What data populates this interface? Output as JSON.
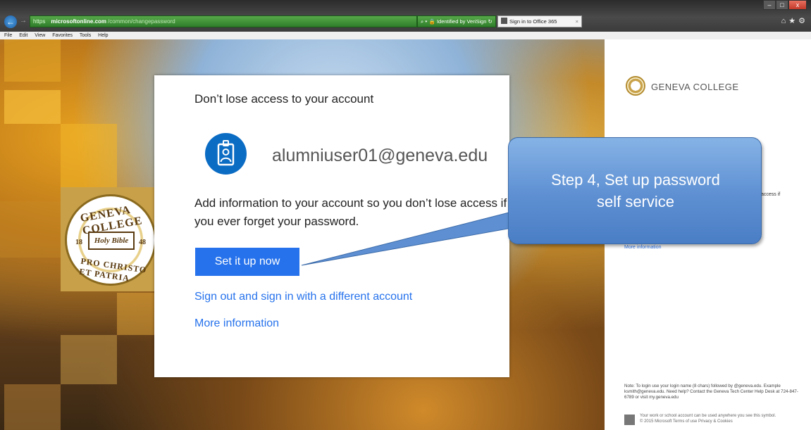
{
  "browser": {
    "address_scheme": "https",
    "address_host": "microsoftonline.com",
    "address_path": "/common/changepassword",
    "cert_text": "⌕ ▾  🔒 Identified by VeriSign  ↻",
    "tab_title": "Sign in to Office 365",
    "tab_close": "×",
    "back_glyph": "←",
    "fwd_glyph": "→",
    "win_min": "–",
    "win_max": "□",
    "win_close": "x",
    "tool_icons": "⌂★⚙",
    "menu": [
      "File",
      "Edit",
      "View",
      "Favorites",
      "Tools",
      "Help"
    ]
  },
  "seal": {
    "top": "GENEVA COLLEGE",
    "book": "Holy Bible",
    "year_left": "18",
    "year_right": "48",
    "bottom": "PRO CHRISTO ET PATRIA"
  },
  "right_pane": {
    "org_name": "GENEVA COLLEGE",
    "access_fragment": "access if",
    "more_information": "More information",
    "note": "Note: To login use your login name (8 chars) followed by @geneva.edu. Example ksmith@geneva.edu. Need help? Contact the Geneva Tech Center Help Desk at 724-847-6789 or visit my.geneva.edu",
    "footer_line1": "Your work or school account can be used anywhere you see this symbol.",
    "footer_line2": "© 2015 Microsoft  Terms of use  Privacy & Cookies"
  },
  "modal": {
    "title": "Don’t lose access to your account",
    "email": "alumniuser01@geneva.edu",
    "description": "Add information to your account so you don’t lose access if you ever forget your password.",
    "button_label": "Set it up now",
    "link_switch": "Sign out and sign in with a different account",
    "link_more": "More information"
  },
  "callout": {
    "line1": "Step 4, Set up password",
    "line2": "self service"
  },
  "colors": {
    "accent_blue": "#2672ec",
    "avatar_blue": "#0b6cc4",
    "callout_blue": "#5d8fd2"
  }
}
